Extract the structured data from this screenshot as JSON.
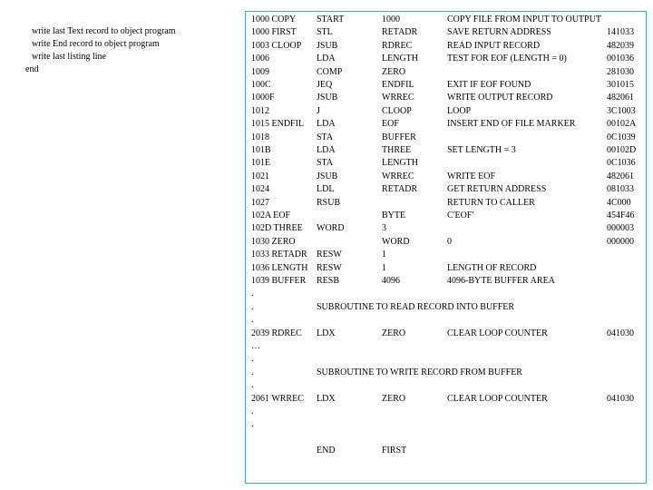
{
  "left_notes": [
    {
      "text": "write last Text record to object program",
      "indent": true
    },
    {
      "text": "write End record to object program",
      "indent": true
    },
    {
      "text": "write last listing line",
      "indent": true
    },
    {
      "text": "end",
      "indent": false
    }
  ],
  "listing": {
    "rows": [
      {
        "loc": "1000   COPY",
        "op": "START",
        "operand": "1000",
        "comment": "COPY FILE FROM INPUT TO OUTPUT",
        "obj": ""
      },
      {
        "loc": "1000 FIRST",
        "op": "STL",
        "operand": "RETADR",
        "comment": "SAVE RETURN ADDRESS",
        "obj": "141033"
      },
      {
        "loc": "1003 CLOOP",
        "op": "JSUB",
        "operand": "RDREC",
        "comment": "READ INPUT RECORD",
        "obj": "482039"
      },
      {
        "loc": "1006",
        "op": "LDA",
        "operand": "LENGTH",
        "comment": "TEST FOR EOF (LENGTH = 0)",
        "obj": "001036"
      },
      {
        "loc": "1009",
        "op": "COMP",
        "operand": "ZERO",
        "comment": "",
        "obj": "281030"
      },
      {
        "loc": "100C",
        "op": "JEQ",
        "operand": "ENDFIL",
        "comment": "EXIT IF EOF FOUND",
        "obj": "301015"
      },
      {
        "loc": "1000F",
        "op": "JSUB",
        "operand": "WRREC",
        "comment": "WRITE OUTPUT RECORD",
        "obj": "482061"
      },
      {
        "loc": "1012",
        "op": "J",
        "operand": "CLOOP",
        "comment": "LOOP",
        "obj": "3C1003"
      },
      {
        "loc": "1015 ENDFIL",
        "op": "LDA",
        "operand": "EOF",
        "comment": "INSERT END OF FILE MARKER",
        "obj": "00102A"
      },
      {
        "loc": "1018",
        "op": "STA",
        "operand": "BUFFER",
        "comment": "",
        "obj": "0C1039"
      },
      {
        "loc": "101B",
        "op": "LDA",
        "operand": "THREE",
        "comment": "SET LENGTH = 3",
        "obj": "00102D"
      },
      {
        "loc": "101E",
        "op": "STA",
        "operand": "LENGTH",
        "comment": "",
        "obj": "0C1036"
      },
      {
        "loc": "1021",
        "op": "JSUB",
        "operand": "WRREC",
        "comment": "WRITE EOF",
        "obj": "482061"
      },
      {
        "loc": "1024",
        "op": "LDL",
        "operand": "RETADR",
        "comment": "GET RETURN   ADDRESS",
        "obj": "081033"
      },
      {
        "loc": "1027",
        "op": "RSUB",
        "operand": "",
        "comment": "RETURN TO CALLER",
        "obj": "4C000"
      },
      {
        "loc": "102A EOF",
        "op": "",
        "operand": "BYTE",
        "comment": "C'EOF'",
        "obj": "454F46"
      },
      {
        "loc": "102D THREE",
        "op": "WORD",
        "operand": "3",
        "comment": "",
        "obj": "000003"
      },
      {
        "loc": "1030 ZERO",
        "op": "",
        "operand": "WORD",
        "comment": "0",
        "obj": "000000"
      },
      {
        "loc": "1033 RETADR",
        "op": "RESW",
        "operand": "1",
        "comment": "",
        "obj": ""
      },
      {
        "loc": "1036 LENGTH",
        "op": "RESW",
        "operand": "1",
        "comment": "LENGTH OF RECORD",
        "obj": ""
      },
      {
        "loc": "1039 BUFFER",
        "op": "RESB",
        "operand": "4096",
        "comment": "4096-BYTE BUFFER AREA",
        "obj": ""
      },
      {
        "loc": ".",
        "op": "",
        "operand": "",
        "comment": "",
        "obj": ""
      },
      {
        "loc": ".",
        "sub": "SUBROUTINE TO READ RECORD INTO BUFFER"
      },
      {
        "loc": ".",
        "op": "",
        "operand": "",
        "comment": "",
        "obj": ""
      },
      {
        "loc": "2039 RDREC",
        "op": "LDX",
        "operand": "ZERO",
        "comment": "CLEAR LOOP COUNTER",
        "obj": "041030"
      },
      {
        "loc": "…",
        "op": "",
        "operand": "",
        "comment": "",
        "obj": ""
      },
      {
        "loc": ".",
        "op": "",
        "operand": "",
        "comment": "",
        "obj": ""
      },
      {
        "loc": ".",
        "sub": "SUBROUTINE TO WRITE RECORD FROM BUFFER"
      },
      {
        "loc": ".",
        "op": "",
        "operand": "",
        "comment": "",
        "obj": ""
      },
      {
        "loc": "2061 WRREC",
        "op": "LDX",
        "operand": "ZERO",
        "comment": "CLEAR LOOP COUNTER",
        "obj": "041030"
      },
      {
        "loc": ".",
        "op": "",
        "operand": "",
        "comment": "",
        "obj": ""
      },
      {
        "loc": ".",
        "op": "",
        "operand": "",
        "comment": "",
        "obj": ""
      },
      {
        "loc": "",
        "op": "",
        "operand": "",
        "comment": "",
        "obj": ""
      },
      {
        "loc": "",
        "op": "END",
        "operand": "FIRST",
        "comment": "",
        "obj": ""
      }
    ]
  }
}
